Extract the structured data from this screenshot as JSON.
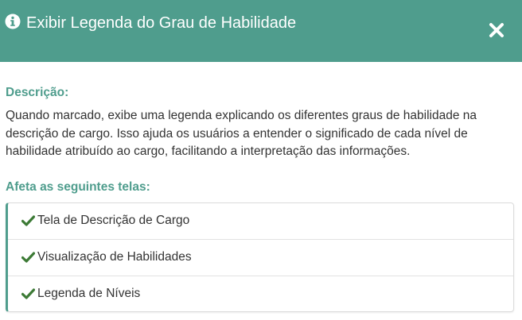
{
  "modal": {
    "title": "Exibir Legenda do Grau de Habilidade",
    "header_color": "#4f9d8d",
    "info_icon": "info-circle-icon",
    "close_icon": "close-icon"
  },
  "description": {
    "label": "Descrição:",
    "text": "Quando marcado, exibe uma legenda explicando os diferentes graus de habilidade na descrição de cargo. Isso ajuda os usuários a entender o significado de cada nível de habilidade atribuído ao cargo, facilitando a interpretação das informações."
  },
  "affects": {
    "label": "Afeta as seguintes telas:",
    "item_icon": "check-icon",
    "check_color": "#3c7a35",
    "items": [
      {
        "label": "Tela de Descrição de Cargo"
      },
      {
        "label": "Visualização de Habilidades"
      },
      {
        "label": "Legenda de Níveis"
      }
    ]
  }
}
